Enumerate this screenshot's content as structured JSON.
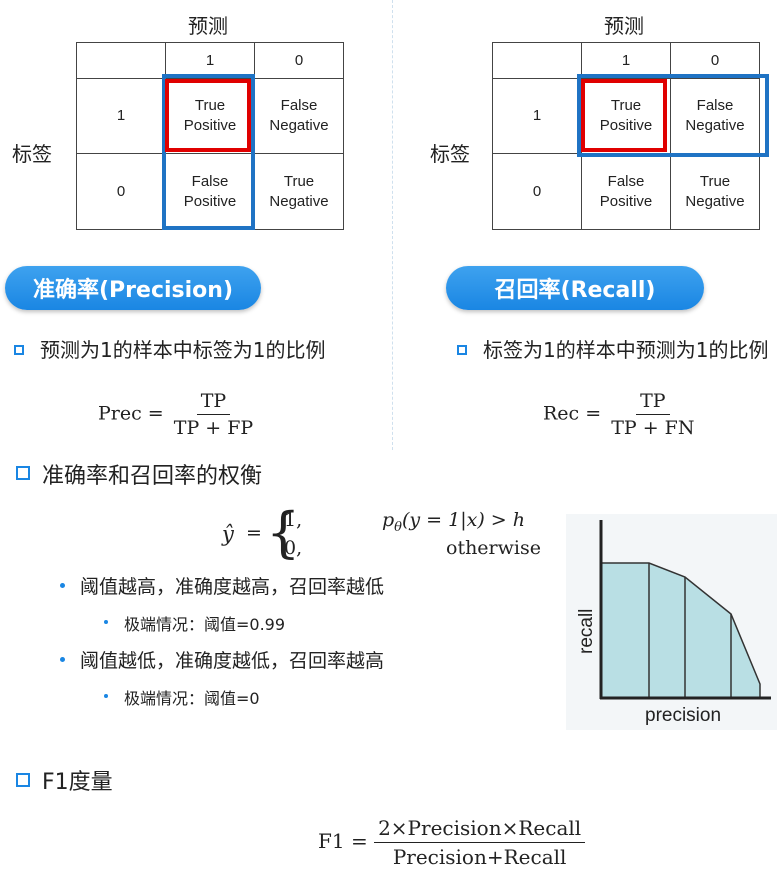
{
  "left": {
    "title": "预测",
    "ylabel": "标签",
    "header": [
      "1",
      "0"
    ],
    "rows": [
      {
        "label": "1",
        "cells": [
          "True\nPositive",
          "False\nNegative"
        ]
      },
      {
        "label": "0",
        "cells": [
          "False\nPositive",
          "True\nNegative"
        ]
      }
    ],
    "pill": "准确率(Precision)",
    "desc": "预测为1的样本中标签为1的比例",
    "formula": {
      "lhs": "Prec =",
      "num": "TP",
      "den": "TP + FP"
    }
  },
  "right": {
    "title": "预测",
    "ylabel": "标签",
    "header": [
      "1",
      "0"
    ],
    "rows": [
      {
        "label": "1",
        "cells": [
          "True\nPositive",
          "False\nNegative"
        ]
      },
      {
        "label": "0",
        "cells": [
          "False\nPositive",
          "True\nNegative"
        ]
      }
    ],
    "pill": "召回率(Recall)",
    "desc": "标签为1的样本中预测为1的比例",
    "formula": {
      "lhs": "Rec =",
      "num": "TP",
      "den": "TP + FN"
    }
  },
  "tradeoff": {
    "heading": "准确率和召回率的权衡",
    "bullets": [
      {
        "text": "阈值越高，准确度越高，召回率越低",
        "sub": "极端情况：阈值=0.99"
      },
      {
        "text": "阈值越低，准确度越低，召回率越高",
        "sub": "极端情况：阈值=0"
      }
    ],
    "equation": {
      "case1_val": "1,",
      "case2_val": "0,",
      "case2_cond": "otherwise"
    }
  },
  "pr_chart": {
    "xlabel": "precision",
    "ylabel": "recall",
    "colors": {
      "fill": "#b9dfe4",
      "stroke": "#333333",
      "bg": "#f3f6f8"
    }
  },
  "f1": {
    "heading": "F1度量",
    "lhs": "F1 =",
    "num": "2×Precision×Recall",
    "den": "Precision+Recall"
  },
  "colors": {
    "accent": "#1a86e3",
    "red_box": "#e00000",
    "blue_box": "#1f73c4"
  }
}
